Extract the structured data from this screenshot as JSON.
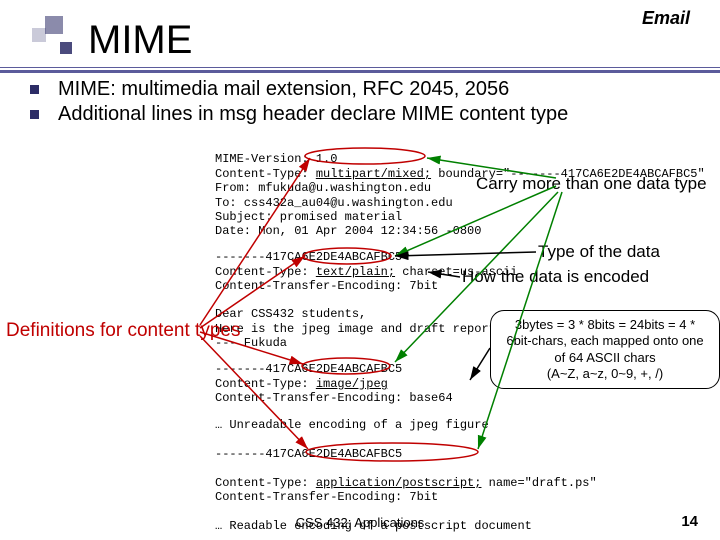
{
  "header": {
    "category": "Email"
  },
  "title": "MIME",
  "bullets": [
    "MIME: multimedia mail extension, RFC 2045, 2056",
    "Additional lines in msg header declare MIME content type"
  ],
  "mime_block1": {
    "l1a": "MIME-Version: 1.0",
    "l2a": "Content-Type: ",
    "l2b": "multipart/mixed;",
    "l2c": " boundary=\"-------417CA6E2DE4ABCAFBC5\"",
    "l3a": "From: mfukuda@u.washington.edu",
    "l4a": "To: css432a_au04@u.washington.edu",
    "l5a": "Subject: promised material",
    "l6a": "Date: Mon, 01 Apr 2004 12:34:56 -0800"
  },
  "mime_block2": {
    "l1": "-------417CA6E2DE4ABCAFBC5",
    "l2a": "Content-Type: ",
    "l2b": "text/plain;",
    "l2c": " charset=us-ascii",
    "l3": "Content-Transfer-Encoding: 7bit"
  },
  "mime_block3": {
    "l1": "Dear CSS432 students,",
    "l2": "Here is the jpeg image and draft report I promised.",
    "l3": "--- Fukuda"
  },
  "mime_block4": {
    "l1": "-------417CA6E2DE4ABCAFBC5",
    "l2a": "Content-Type: ",
    "l2b": "image/jpeg",
    "l3": "Content-Transfer-Encoding: base64"
  },
  "mime_block5": {
    "l1": "… Unreadable encoding of a jpeg figure",
    "l2": "-------417CA6E2DE4ABCAFBC5",
    "l3a": "Content-Type: ",
    "l3b": "application/postscript;",
    "l3c": " name=\"draft.ps\"",
    "l4": "Content-Transfer-Encoding: 7bit",
    "l5": "… Readable encoding of a postscript document"
  },
  "callouts": {
    "carry": "Carry more than one data type",
    "typeof": "Type of the data",
    "encoded": "How the data is encoded",
    "defs": "Definitions for content types"
  },
  "box": {
    "l1": "3bytes = 3 * 8bits = 24bits = 4 *",
    "l2": "6bit-chars, each mapped onto one",
    "l3": "of 64 ASCII chars",
    "l4": "(A~Z, a~z, 0~9, +, /)"
  },
  "footer": "CSS 432: Applications",
  "page": "14"
}
